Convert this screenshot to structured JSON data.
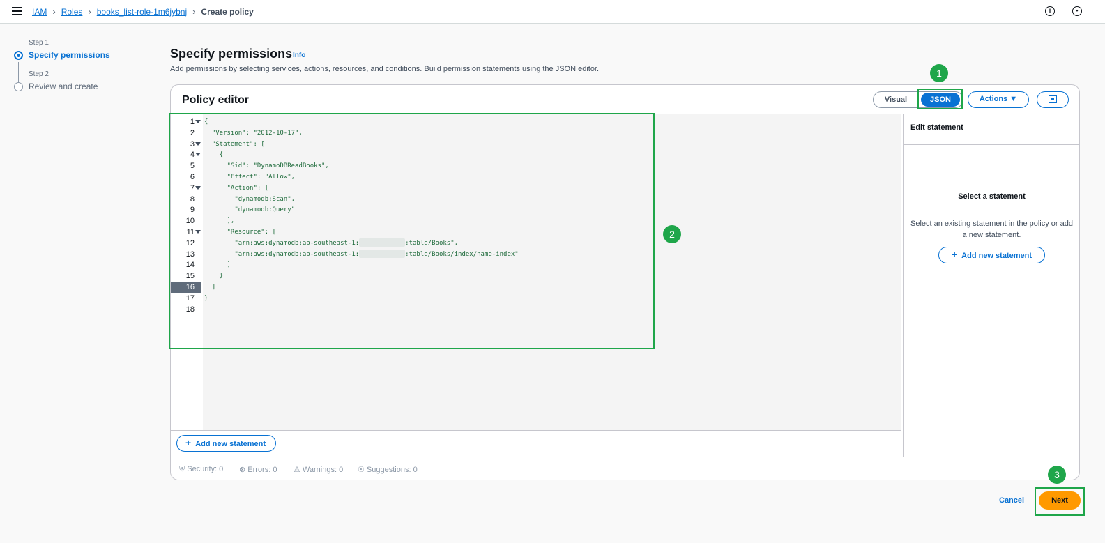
{
  "breadcrumbs": [
    "IAM",
    "Roles",
    "books_list-role-1m6jybnj",
    "Create policy"
  ],
  "top_icons": [
    "info-icon",
    "settings-icon"
  ],
  "steps": [
    {
      "label": "Step 1",
      "name": "Specify permissions",
      "active": true
    },
    {
      "label": "Step 2",
      "name": "Review and create",
      "active": false
    }
  ],
  "header": {
    "title": "Specify permissions",
    "info": "Info",
    "description": "Add permissions by selecting services, actions, resources, and conditions. Build permission statements using the JSON editor."
  },
  "editor": {
    "title": "Policy editor",
    "visual_label": "Visual",
    "json_label": "JSON",
    "actions_label": "Actions ▼",
    "add_statement_label": "Add new statement"
  },
  "code_lines": [
    {
      "n": "1",
      "text": "{"
    },
    {
      "n": "2",
      "text": "  \"Version\": \"2012-10-17\","
    },
    {
      "n": "3",
      "text": "  \"Statement\": ["
    },
    {
      "n": "4",
      "text": "    {"
    },
    {
      "n": "5",
      "text": "      \"Sid\": \"DynamoDBReadBooks\","
    },
    {
      "n": "6",
      "text": "      \"Effect\": \"Allow\","
    },
    {
      "n": "7",
      "text": "      \"Action\": ["
    },
    {
      "n": "8",
      "text": "        \"dynamodb:Scan\","
    },
    {
      "n": "9",
      "text": "        \"dynamodb:Query\""
    },
    {
      "n": "10",
      "text": "      ],"
    },
    {
      "n": "11",
      "text": "      \"Resource\": ["
    },
    {
      "n": "12",
      "text": "        \"arn:aws:dynamodb:ap-southeast-1:",
      "tail": ":table/Books\","
    },
    {
      "n": "13",
      "text": "        \"arn:aws:dynamodb:ap-southeast-1:",
      "tail": ":table/Books/index/name-index\""
    },
    {
      "n": "14",
      "text": "      ]"
    },
    {
      "n": "15",
      "text": "    }"
    },
    {
      "n": "16",
      "text": "  ]"
    },
    {
      "n": "17",
      "text": "}"
    },
    {
      "n": "18",
      "text": ""
    }
  ],
  "side_panel": {
    "header": "Edit statement",
    "select_title": "Select a statement",
    "select_desc": "Select an existing statement in the policy or add a new statement.",
    "add_label": "Add new statement"
  },
  "status": {
    "security": "Security: 0",
    "errors": "Errors: 0",
    "warnings": "Warnings: 0",
    "suggestions": "Suggestions: 0"
  },
  "footer": {
    "cancel": "Cancel",
    "next": "Next"
  },
  "annotations": [
    "1",
    "2",
    "3"
  ],
  "colors": {
    "primary": "#0972d3",
    "next": "#ff9900",
    "highlight": "#1fa64a"
  }
}
